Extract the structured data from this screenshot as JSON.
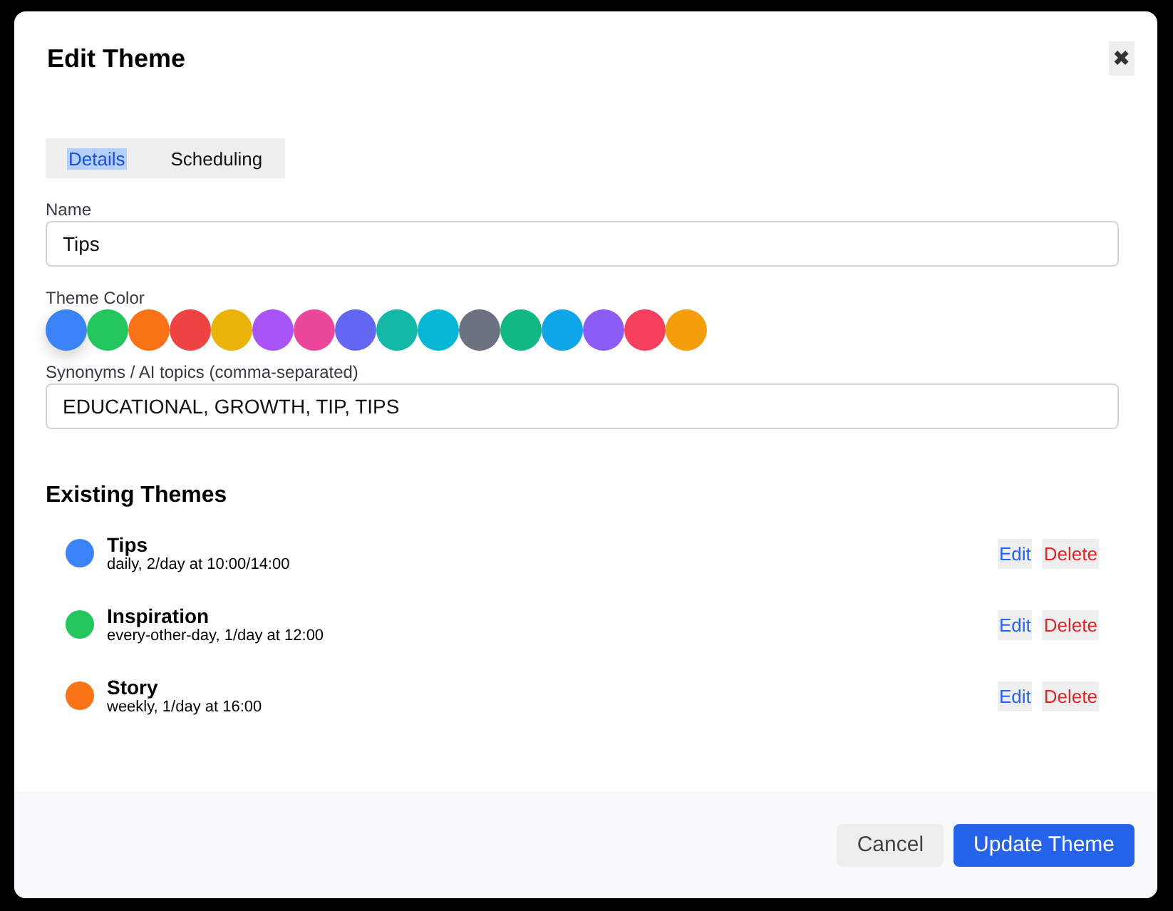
{
  "dialog": {
    "title": "Edit Theme",
    "close": "✖"
  },
  "tabs": [
    {
      "label": "Details",
      "selected": true
    },
    {
      "label": "Scheduling",
      "selected": false
    }
  ],
  "form": {
    "name_label": "Name",
    "name_value": "Tips",
    "color_label": "Theme Color",
    "colors": [
      {
        "color": "#3b82f6",
        "selected": true
      },
      {
        "color": "#22c55e",
        "selected": false
      },
      {
        "color": "#f97316",
        "selected": false
      },
      {
        "color": "#ef4444",
        "selected": false
      },
      {
        "color": "#eab308",
        "selected": false
      },
      {
        "color": "#a855f7",
        "selected": false
      },
      {
        "color": "#ec4899",
        "selected": false
      },
      {
        "color": "#6366f1",
        "selected": false
      },
      {
        "color": "#14b8a6",
        "selected": false
      },
      {
        "color": "#06b6d4",
        "selected": false
      },
      {
        "color": "#6b7280",
        "selected": false
      },
      {
        "color": "#10b981",
        "selected": false
      },
      {
        "color": "#0ea5e9",
        "selected": false
      },
      {
        "color": "#8b5cf6",
        "selected": false
      },
      {
        "color": "#f43f5e",
        "selected": false
      },
      {
        "color": "#f59e0b",
        "selected": false
      }
    ],
    "synonyms_label": "Synonyms / AI topics (comma-separated)",
    "synonyms_value": "EDUCATIONAL, GROWTH, TIP, TIPS"
  },
  "existing": {
    "heading": "Existing Themes",
    "themes": [
      {
        "name": "Tips",
        "schedule": "daily, 2/day at 10:00/14:00",
        "color": "#3b82f6",
        "edit": "Edit",
        "delete": "Delete"
      },
      {
        "name": "Inspiration",
        "schedule": "every-other-day, 1/day at 12:00",
        "color": "#22c55e",
        "edit": "Edit",
        "delete": "Delete"
      },
      {
        "name": "Story",
        "schedule": "weekly, 1/day at 16:00",
        "color": "#f97316",
        "edit": "Edit",
        "delete": "Delete"
      }
    ]
  },
  "footer": {
    "cancel": "Cancel",
    "submit": "Update Theme"
  }
}
